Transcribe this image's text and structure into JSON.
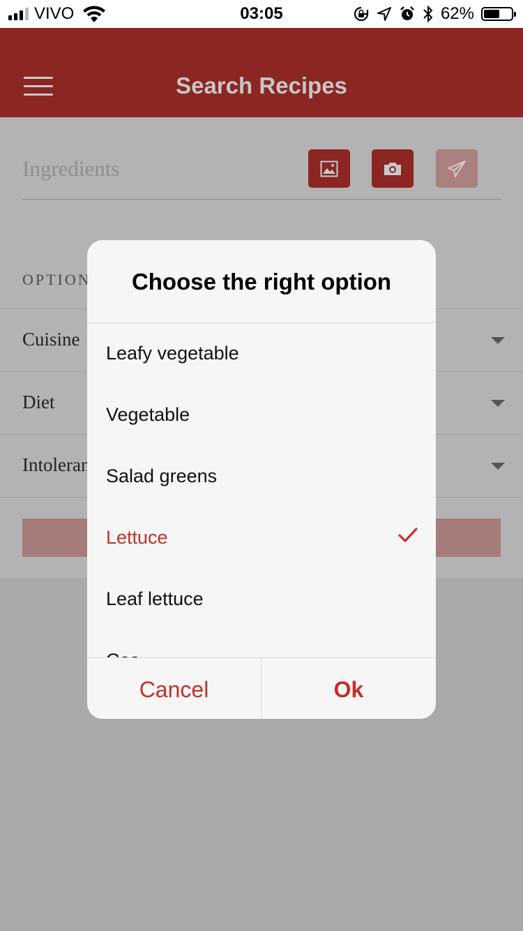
{
  "status_bar": {
    "carrier": "VIVO",
    "time": "03:05",
    "battery_percent": "62%",
    "battery_level": 0.62,
    "signal_bars": 3,
    "icons": [
      "signal-icon",
      "wifi-icon",
      "orientation-lock-icon",
      "location-icon",
      "alarm-icon",
      "bluetooth-icon",
      "battery-icon"
    ]
  },
  "header": {
    "title": "Search Recipes",
    "menu_icon": "hamburger-menu-icon",
    "background": "#8b2623"
  },
  "search": {
    "ingredients_label": "Ingredients",
    "buttons": [
      {
        "icon": "image-icon",
        "enabled": true
      },
      {
        "icon": "camera-icon",
        "enabled": true
      },
      {
        "icon": "send-icon",
        "enabled": false
      }
    ]
  },
  "options": {
    "section_label": "OPTION",
    "rows": [
      {
        "label": "Cuisine"
      },
      {
        "label": "Diet"
      },
      {
        "label": "Intoleran"
      }
    ]
  },
  "dialog": {
    "title": "Choose the right option",
    "items": [
      {
        "label": "Leafy vegetable",
        "selected": false
      },
      {
        "label": "Vegetable",
        "selected": false
      },
      {
        "label": "Salad greens",
        "selected": false
      },
      {
        "label": "Lettuce",
        "selected": true
      },
      {
        "label": "Leaf lettuce",
        "selected": false
      },
      {
        "label": "Cos",
        "selected": false
      }
    ],
    "cancel_label": "Cancel",
    "ok_label": "Ok",
    "accent_color": "#c2302a"
  }
}
